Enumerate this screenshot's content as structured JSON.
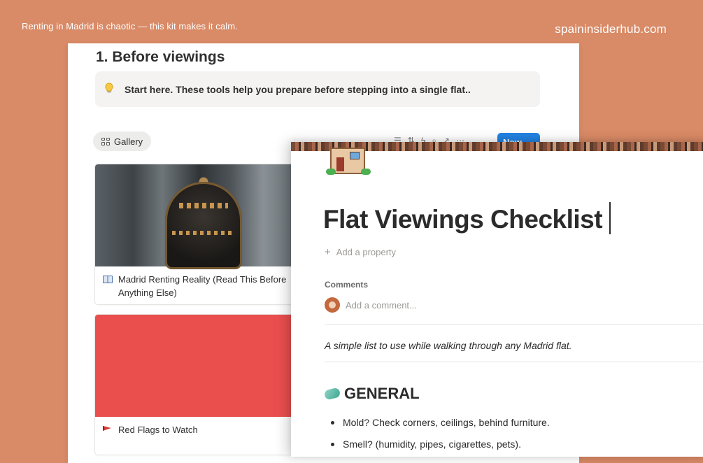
{
  "banner": {
    "tagline": "Renting in Madrid is chaotic — this kit makes it calm.",
    "domain": "spaininsiderhub.com"
  },
  "back_page": {
    "section_heading": "1. Before viewings",
    "callout": {
      "icon": "lightbulb-icon",
      "text": "Start here. These tools help you prepare before stepping into a single flat.."
    },
    "view_tab": {
      "icon": "gallery-grid-icon",
      "label": "Gallery"
    },
    "toolbar_icons": [
      "filter-icon",
      "sort-icon",
      "lightning-icon",
      "search-icon",
      "expand-icon",
      "settings-icon"
    ],
    "new_button": "New",
    "cards": [
      {
        "icon": "book-icon",
        "title": "Madrid Renting Reality (Read This Before Anything Else)",
        "cover": "madrid-building-photo"
      },
      {
        "icon": "red-flag-icon",
        "title": "Red Flags to Watch",
        "cover": "red-cover",
        "cover_color": "#ea4f4e"
      }
    ]
  },
  "front_page": {
    "icon": "house-icon",
    "title": "Flat Viewings Checklist",
    "add_property": "Add a property",
    "comments_label": "Comments",
    "comment_placeholder": "Add a comment...",
    "description": "A simple list to use while walking through any Madrid flat.",
    "section": {
      "icon": "soap-icon",
      "title": "GENERAL"
    },
    "items": [
      "Mold? Check corners, ceilings, behind furniture.",
      "Smell? (humidity, pipes, cigarettes, pets)."
    ]
  },
  "colors": {
    "background": "#d98a66",
    "accent_blue": "#2383e2",
    "card_red": "#ea4f4e"
  }
}
